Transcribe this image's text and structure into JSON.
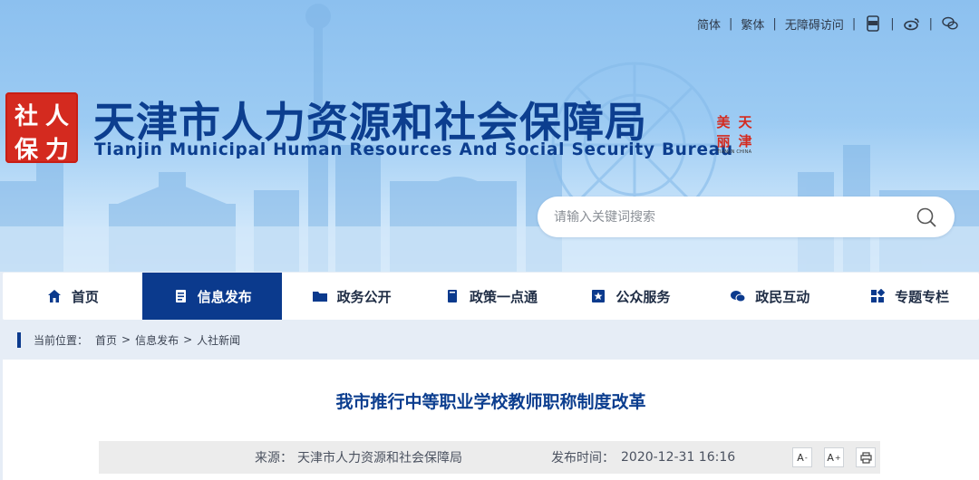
{
  "top_links": {
    "simplified": "简体",
    "traditional": "繁体",
    "accessible": "无障碍访问",
    "icons": [
      "app-icon",
      "weibo-icon",
      "wechat-icon"
    ]
  },
  "header": {
    "seal_chars": [
      "社",
      "人",
      "保",
      "力"
    ],
    "title_cn": "天津市人力资源和社会保障局",
    "title_en": "Tianjin Municipal Human Resources And Social Security Bureau",
    "small_seal_chars": [
      "美",
      "天",
      "丽",
      "津"
    ],
    "small_seal_caption": "TIANJIN CHINA"
  },
  "search": {
    "placeholder": "请输入关键词搜索",
    "value": ""
  },
  "nav": {
    "items": [
      {
        "label": "首页",
        "icon": "home-icon"
      },
      {
        "label": "信息发布",
        "icon": "document-icon",
        "active": true
      },
      {
        "label": "政务公开",
        "icon": "folder-icon"
      },
      {
        "label": "政策一点通",
        "icon": "book-icon"
      },
      {
        "label": "公众服务",
        "icon": "star-icon"
      },
      {
        "label": "政民互动",
        "icon": "chat-icon"
      },
      {
        "label": "专题专栏",
        "icon": "grid-icon"
      }
    ]
  },
  "breadcrumb": {
    "prefix": "当前位置：",
    "items": [
      "首页",
      "信息发布",
      "人社新闻"
    ],
    "separator": ">"
  },
  "article": {
    "title": "我市推行中等职业学校教师职称制度改革",
    "source_label": "来源：",
    "source_value": "天津市人力资源和社会保障局",
    "date_label": "发布时间：",
    "date_value": "2020-12-31 16:16",
    "font_decrease": "A",
    "font_increase": "A",
    "font_decrease_mark": "-",
    "font_increase_mark": "+"
  },
  "colors": {
    "brand_blue": "#0c3e8f",
    "nav_active": "#0b3a8d",
    "seal_red": "#d42a1f"
  }
}
